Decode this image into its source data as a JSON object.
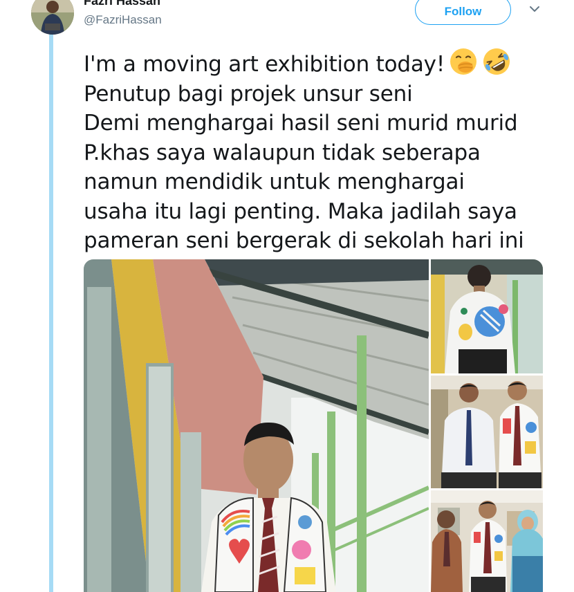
{
  "tweet": {
    "author": {
      "display_name": "Fazri Hassan",
      "handle": "@FazriHassan"
    },
    "follow_label": "Follow",
    "text_lines": [
      "I'm a moving art exhibition today!",
      "Penutup bagi projek unsur seni",
      "Demi menghargai hasil seni murid murid",
      "P.khas saya walaupun tidak seberapa",
      "namun mendidik untuk menghargai",
      "usaha itu lagi penting. Maka jadilah saya",
      "pameran seni bergerak di sekolah hari ini"
    ],
    "emojis": [
      "face-with-hand-over-mouth-icon",
      "rolling-on-floor-laughing-icon"
    ],
    "media": [
      {
        "name": "photo-main",
        "subject": "man in art-painted vest on school corridor"
      },
      {
        "name": "photo-back",
        "subject": "back view of painted shirt"
      },
      {
        "name": "photo-two-men",
        "subject": "two men in corridor"
      },
      {
        "name": "photo-group",
        "subject": "three people in office"
      }
    ]
  },
  "colors": {
    "accent": "#1da1f2",
    "thread_line": "#a6dbf5",
    "text": "#14171a",
    "muted": "#657786"
  }
}
